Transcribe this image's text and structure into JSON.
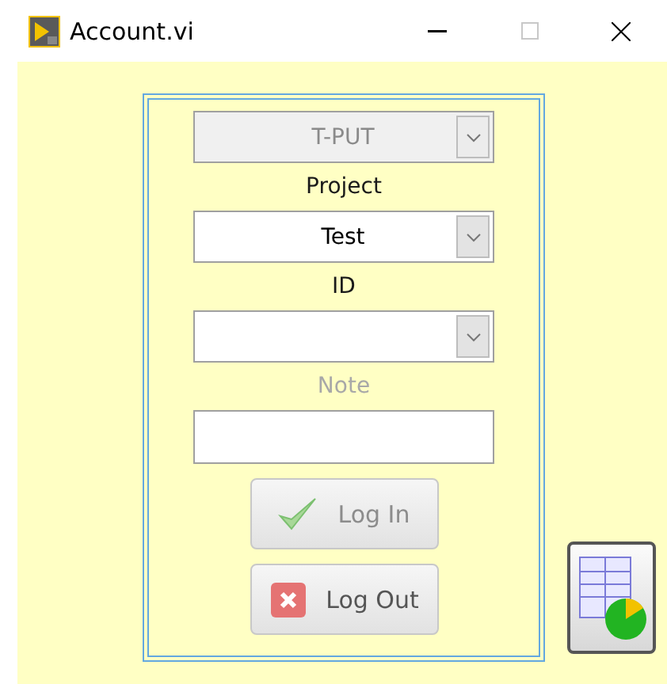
{
  "window": {
    "title": "Account.vi",
    "maximize_disabled": true
  },
  "fields": [
    {
      "kind": "dropdown",
      "value": "T-PUT",
      "disabled": true
    },
    {
      "kind": "label",
      "text": "Project",
      "disabled": false
    },
    {
      "kind": "dropdown",
      "value": "Test",
      "disabled": false
    },
    {
      "kind": "label",
      "text": "ID",
      "disabled": false
    },
    {
      "kind": "dropdown",
      "disabled": false
    },
    {
      "kind": "label",
      "text": "Note",
      "disabled": true
    },
    {
      "kind": "input"
    }
  ],
  "buttons": [
    {
      "kind": "login",
      "label": "Log In",
      "disabled": true
    },
    {
      "kind": "logout",
      "label": "Log Out",
      "disabled": false
    }
  ]
}
